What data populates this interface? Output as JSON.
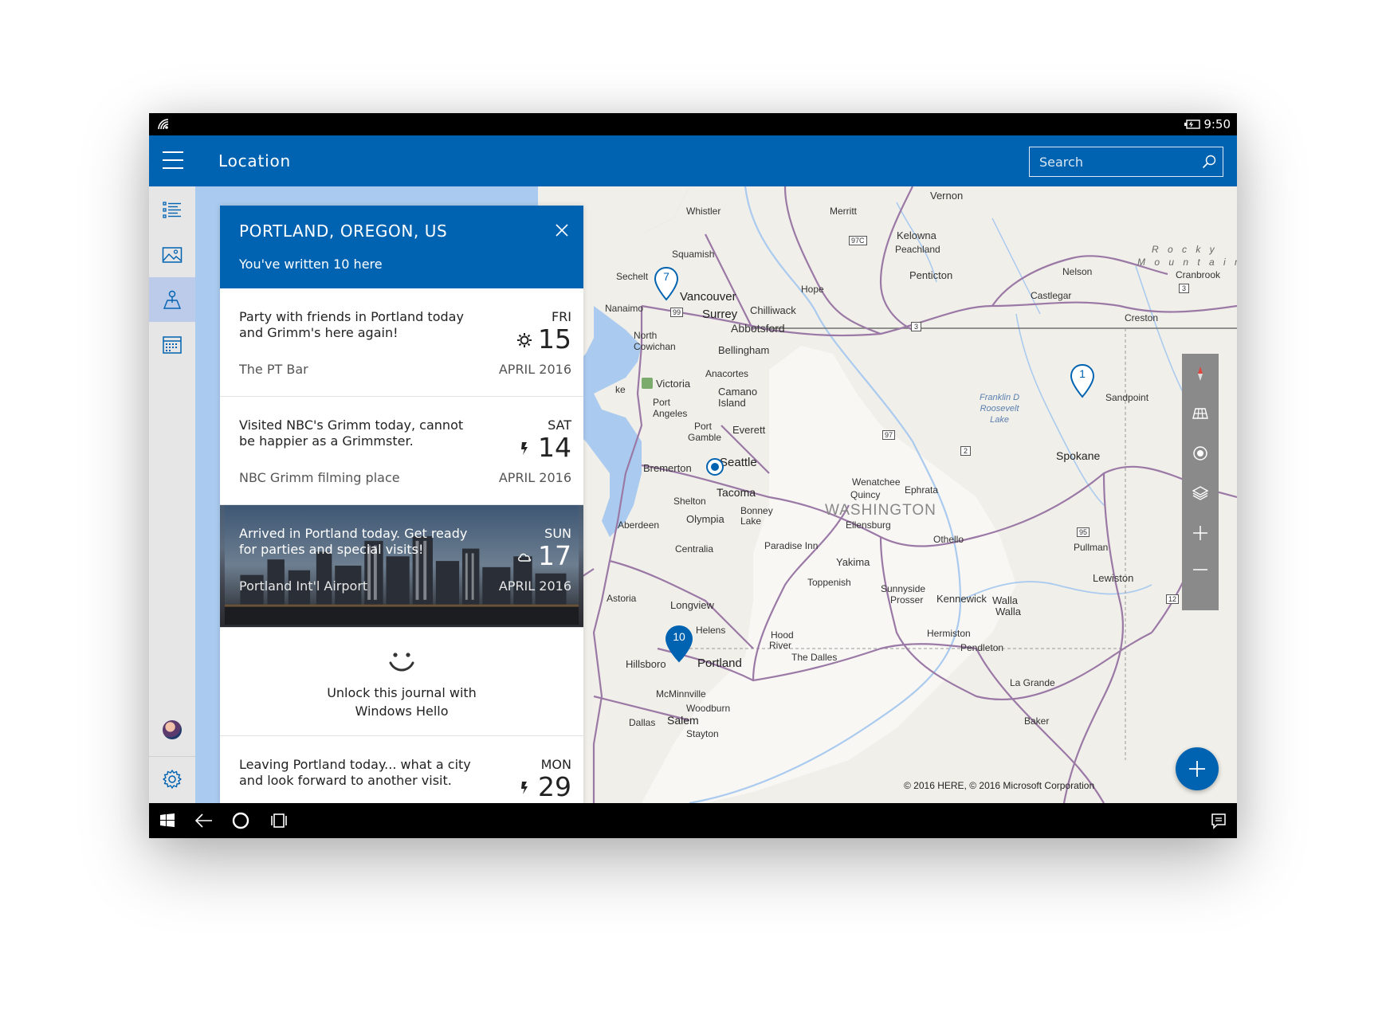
{
  "status_bar": {
    "time": "9:50"
  },
  "header": {
    "title": "Location",
    "search_placeholder": "Search"
  },
  "panel": {
    "title": "PORTLAND, OREGON, US",
    "subtitle": "You've written 10 here",
    "entries": [
      {
        "text": "Party with friends in Portland today and Grimm's here again!",
        "place": "The PT Bar",
        "day": "FRI",
        "date": "15",
        "month": "APRIL 2016",
        "icon": "sun-icon"
      },
      {
        "text": "Visited NBC's Grimm today, cannot be happier as a Grimmster.",
        "place": "NBC Grimm filming place",
        "day": "SAT",
        "date": "14",
        "month": "APRIL 2016",
        "icon": "lightning-icon"
      },
      {
        "text": "Arrived in Portland today. Get ready for parties and special visits!",
        "place": "Portland Int'l Airport",
        "day": "SUN",
        "date": "17",
        "month": "APRIL 2016",
        "icon": "cloud-icon"
      },
      {
        "text": "Leaving Portland today... what a city and look forward to another visit.",
        "place": "",
        "day": "MON",
        "date": "29",
        "month": "",
        "icon": "lightning-icon"
      }
    ],
    "hello": {
      "line1": "Unlock this journal with",
      "line2": "Windows Hello"
    }
  },
  "map": {
    "copyright": "© 2016 HERE, © 2016 Microsoft Corporation",
    "pins": [
      "7",
      "1",
      "10"
    ],
    "labels": {
      "vernon": "Vernon",
      "whistler": "Whistler",
      "merritt": "Merritt",
      "kelowna": "Kelowna",
      "peachland": "Peachland",
      "squamish": "Squamish",
      "sechelt": "Sechelt",
      "vancouver": "Vancouver",
      "nanaimo": "Nanaimo",
      "surrey": "Surrey",
      "chilliwack": "Chilliwack",
      "hope": "Hope",
      "abbotsford": "Abbotsford",
      "penticton": "Penticton",
      "nelson": "Nelson",
      "castlegar": "Castlegar",
      "creston": "Creston",
      "cranbrook": "Cranbrook",
      "rocky": "R o c k y",
      "mountains": "M o u n t a i n s",
      "northcowichan1": "North",
      "northcowichan2": "Cowichan",
      "bellingham": "Bellingham",
      "anacortes": "Anacortes",
      "victoria": "Victoria",
      "camano1": "Camano",
      "camano2": "Island",
      "port_angeles1": "Port",
      "port_angeles2": "Angeles",
      "port_gamble1": "Port",
      "port_gamble2": "Gamble",
      "everett": "Everett",
      "bremerton": "Bremerton",
      "seattle": "Seattle",
      "shelton": "Shelton",
      "tacoma": "Tacoma",
      "bonney1": "Bonney",
      "bonney2": "Lake",
      "olympia": "Olympia",
      "aberdeen": "Aberdeen",
      "centralia": "Centralia",
      "paradise": "Paradise Inn",
      "wenatchee": "Wenatchee",
      "ephrata": "Ephrata",
      "quincy": "Quincy",
      "washington": "WASHINGTON",
      "ellensburg": "Ellensburg",
      "othello": "Othello",
      "yakima": "Yakima",
      "toppenish": "Toppenish",
      "sunnyside": "Sunnyside",
      "prosser": "Prosser",
      "kennewick": "Kennewick",
      "walla1": "Walla",
      "walla2": "Walla",
      "spokane": "Spokane",
      "sandpoint": "Sandpoint",
      "pullman": "Pullman",
      "lewiston": "Lewiston",
      "franklin1": "Franklin D",
      "franklin2": "Roosevelt",
      "franklin3": "Lake",
      "astoria": "Astoria",
      "longview": "Longview",
      "helens": "Helens",
      "hood1": "Hood",
      "hood2": "River",
      "thedalles": "The Dalles",
      "hermiston": "Hermiston",
      "pendleton": "Pendleton",
      "lagrande": "La Grande",
      "hillsboro": "Hillsboro",
      "portland": "Portland",
      "mcminnville": "McMinnville",
      "woodburn": "Woodburn",
      "salem": "Salem",
      "stayton": "Stayton",
      "dallas": "Dallas",
      "baker": "Baker",
      "ke": "ke",
      "r97c": "97C",
      "r99": "99",
      "r3a": "3",
      "r3b": "3",
      "r97": "97",
      "r2": "2",
      "r95": "95",
      "r12": "12"
    }
  },
  "colors": {
    "accent": "#0063b1",
    "rail_active": "#bccbea",
    "map_land": "#f1efe9",
    "map_water": "#aacbef",
    "road": "#9b79a6"
  }
}
